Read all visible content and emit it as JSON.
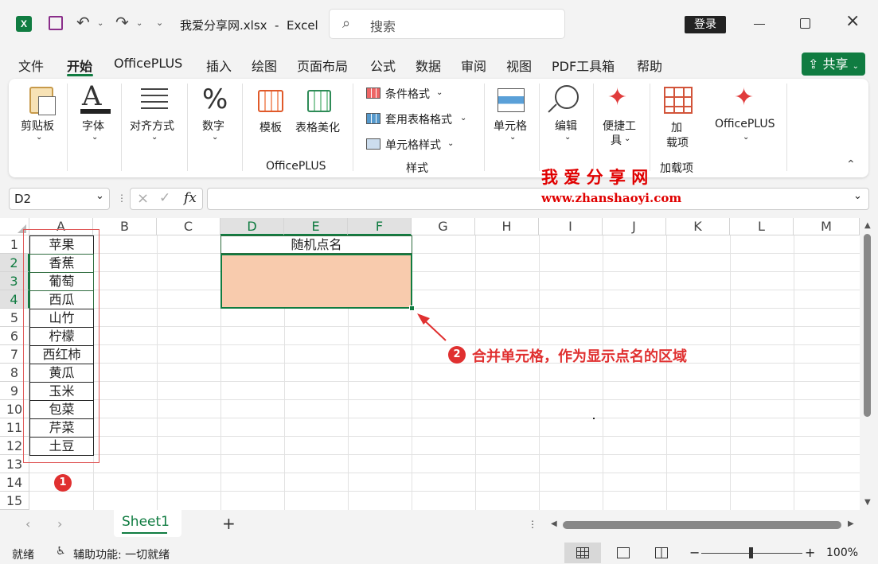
{
  "titlebar": {
    "doc_title": "我爱分享网.xlsx  -  Excel",
    "search_placeholder": "搜索",
    "login_label": "登录"
  },
  "tabs": [
    "文件",
    "开始",
    "OfficePLUS",
    "插入",
    "绘图",
    "页面布局",
    "公式",
    "数据",
    "审阅",
    "视图",
    "PDF工具箱",
    "帮助"
  ],
  "share_label": "共享",
  "ribbon": {
    "clipboard": "剪贴板",
    "font": "字体",
    "align": "对齐方式",
    "number": "数字",
    "template": "模板",
    "beautify": "表格美化",
    "group_officeplus": "OfficePLUS",
    "cond_format": "条件格式",
    "table_format": "套用表格格式",
    "cell_style": "单元格样式",
    "group_styles": "样式",
    "cells": "单元格",
    "edit": "编辑",
    "convenient1": "便捷工",
    "convenient2": "具",
    "addin1": "加",
    "addin2": "载项",
    "officeplus_btn": "OfficePLUS",
    "group_addins": "加载项"
  },
  "watermark": {
    "title": "我 爱 分 享 网",
    "url": "www.zhanshaoyi.com"
  },
  "formula": {
    "namebox": "D2",
    "fx": "fx",
    "value": ""
  },
  "columns": [
    "A",
    "B",
    "C",
    "D",
    "E",
    "F",
    "G",
    "H",
    "I",
    "J",
    "K",
    "L",
    "M"
  ],
  "rows": [
    "1",
    "2",
    "3",
    "4",
    "5",
    "6",
    "7",
    "8",
    "9",
    "10",
    "11",
    "12",
    "13",
    "14",
    "15"
  ],
  "cells": {
    "d1": "随机点名",
    "a": [
      "苹果",
      "香蕉",
      "葡萄",
      "西瓜",
      "山竹",
      "柠檬",
      "西红柿",
      "黄瓜",
      "玉米",
      "包菜",
      "芹菜",
      "土豆"
    ]
  },
  "annotations": {
    "badge1": "1",
    "badge2": "2",
    "callout": "合并单元格，作为显示点名的区域"
  },
  "sheet": {
    "name": "Sheet1",
    "add": "+"
  },
  "status": {
    "ready": "就绪",
    "accessibility": "辅助功能: 一切就绪",
    "zoom": "100%"
  },
  "colors": {
    "excel_green": "#107c41",
    "merged_fill": "#f8cbad",
    "annotation_red": "#e03030",
    "watermark_red": "#e00000"
  }
}
